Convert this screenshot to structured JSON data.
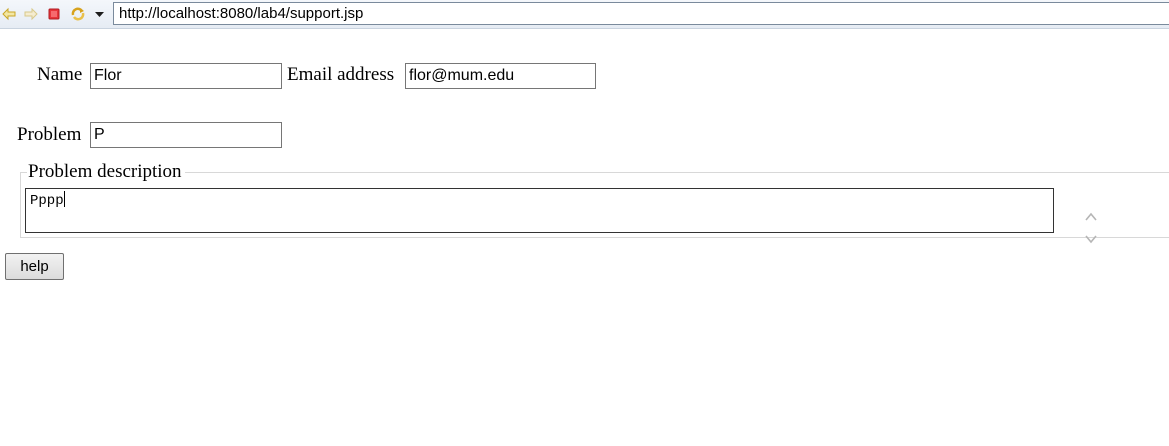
{
  "toolbar": {
    "icons": [
      "back-icon",
      "forward-icon",
      "stop-icon",
      "refresh-icon",
      "dropdown-arrow-icon"
    ],
    "url": "http://localhost:8080/lab4/support.jsp"
  },
  "form": {
    "name_label": "Name",
    "name_value": "Flor",
    "email_label": "Email address",
    "email_value": "flor@mum.edu",
    "problem_label": "Problem",
    "problem_value": "P",
    "description_legend": "Problem description",
    "description_value": "Pppp",
    "submit_label": "help"
  }
}
